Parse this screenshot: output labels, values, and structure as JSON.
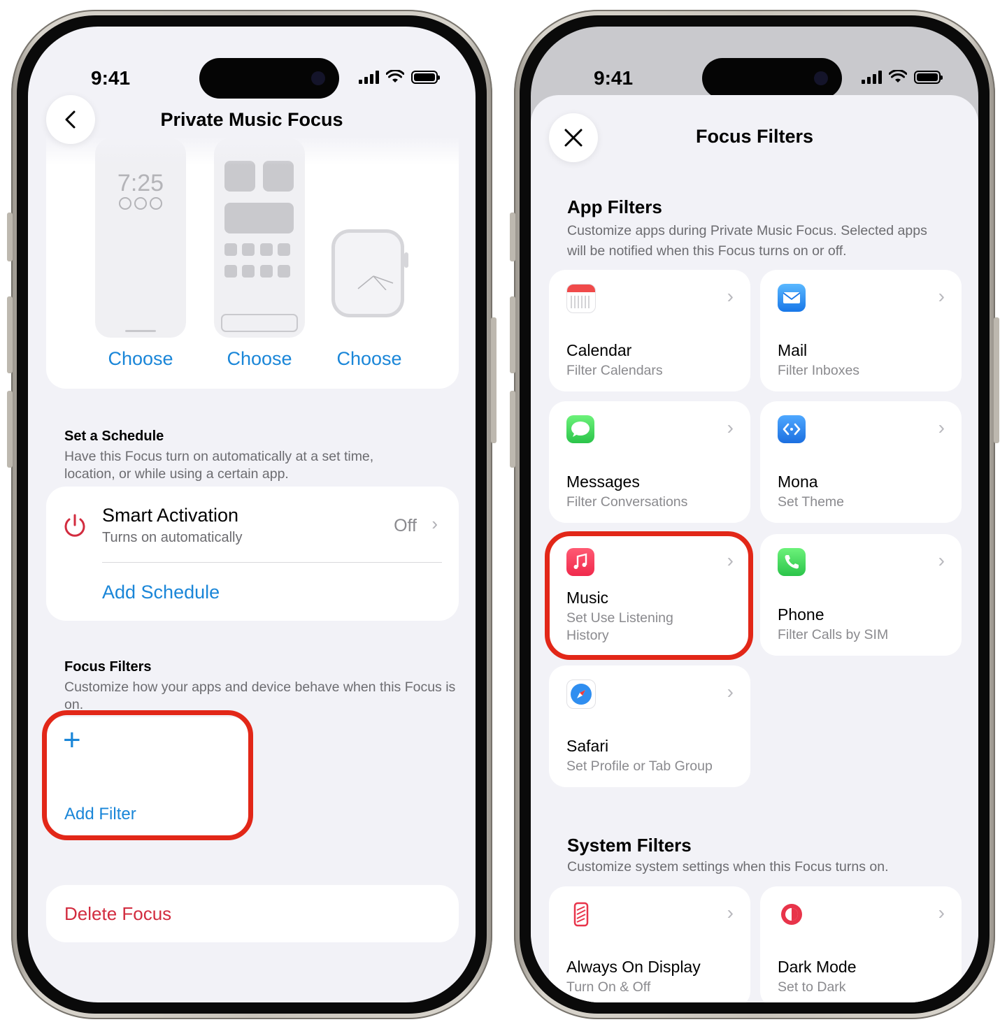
{
  "left": {
    "status": {
      "time": "9:41"
    },
    "nav": {
      "title": "Private Music Focus"
    },
    "customize": {
      "clock_time": "7:25",
      "choose_labels": [
        "Choose",
        "Choose",
        "Choose"
      ]
    },
    "schedule": {
      "title": "Set a Schedule",
      "desc": "Have this Focus turn on automatically at a set time, location, or while using a certain app.",
      "smart_title": "Smart Activation",
      "smart_sub": "Turns on automatically",
      "smart_value": "Off",
      "add_label": "Add Schedule"
    },
    "filters": {
      "title": "Focus Filters",
      "desc": "Customize how your apps and device behave when this Focus is on.",
      "add_icon": "+",
      "add_label": "Add Filter"
    },
    "delete_label": "Delete Focus"
  },
  "right": {
    "status": {
      "time": "9:41"
    },
    "nav": {
      "title": "Focus Filters"
    },
    "app_filters": {
      "title": "App Filters",
      "desc": "Customize apps during Private Music Focus. Selected apps will be notified when this Focus turns on or off.",
      "items": [
        {
          "name": "Calendar",
          "sub": "Filter Calendars",
          "icon": "calendar-icon"
        },
        {
          "name": "Mail",
          "sub": "Filter Inboxes",
          "icon": "mail-icon"
        },
        {
          "name": "Messages",
          "sub": "Filter Conversations",
          "icon": "messages-icon"
        },
        {
          "name": "Mona",
          "sub": "Set Theme",
          "icon": "mona-icon"
        },
        {
          "name": "Music",
          "sub": "Set Use Listening History",
          "icon": "music-icon"
        },
        {
          "name": "Phone",
          "sub": "Filter Calls by SIM",
          "icon": "phone-icon"
        },
        {
          "name": "Safari",
          "sub": "Set Profile or Tab Group",
          "icon": "safari-icon"
        }
      ]
    },
    "system_filters": {
      "title": "System Filters",
      "desc": "Customize system settings when this Focus turns on.",
      "items": [
        {
          "name": "Always On Display",
          "sub": "Turn On & Off",
          "icon": "always-on-display-icon"
        },
        {
          "name": "Dark Mode",
          "sub": "Set to Dark",
          "icon": "dark-mode-icon"
        }
      ]
    }
  },
  "colors": {
    "accent": "#1a86d8",
    "destructive": "#d22c3f",
    "highlight": "#e22718"
  }
}
